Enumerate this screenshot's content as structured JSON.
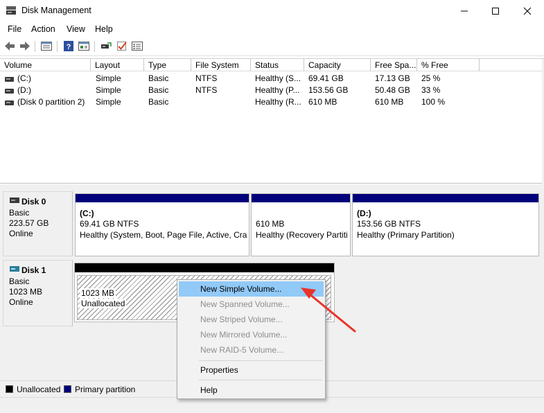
{
  "window": {
    "title": "Disk Management",
    "icon": "disk-management-icon",
    "controls": {
      "minimize": "minimize-icon",
      "maximize": "maximize-icon",
      "close": "close-icon"
    }
  },
  "menu": {
    "items": [
      "File",
      "Action",
      "View",
      "Help"
    ]
  },
  "toolbar": {
    "icons": [
      "back-arrow-icon",
      "forward-arrow-icon",
      "list-view-icon",
      "help-book-icon",
      "properties-icon",
      "connect-icon",
      "checkmark-icon",
      "settings-list-icon"
    ]
  },
  "volume_list": {
    "columns": [
      "Volume",
      "Layout",
      "Type",
      "File System",
      "Status",
      "Capacity",
      "Free Spa...",
      "% Free"
    ],
    "rows": [
      {
        "volume": "(C:)",
        "layout": "Simple",
        "type": "Basic",
        "fs": "NTFS",
        "status": "Healthy (S...",
        "capacity": "69.41 GB",
        "free": "17.13 GB",
        "pct": "25 %"
      },
      {
        "volume": "(D:)",
        "layout": "Simple",
        "type": "Basic",
        "fs": "NTFS",
        "status": "Healthy (P...",
        "capacity": "153.56 GB",
        "free": "50.48 GB",
        "pct": "33 %"
      },
      {
        "volume": "(Disk 0 partition 2)",
        "layout": "Simple",
        "type": "Basic",
        "fs": "",
        "status": "Healthy (R...",
        "capacity": "610 MB",
        "free": "610 MB",
        "pct": "100 %"
      }
    ]
  },
  "disks": [
    {
      "name": "Disk 0",
      "kind": "Basic",
      "size": "223.57 GB",
      "state": "Online",
      "partitions": [
        {
          "label": "(C:)",
          "line1": "69.41 GB NTFS",
          "line2": "Healthy (System, Boot, Page File, Active, Cras"
        },
        {
          "label": "",
          "line1": "610 MB",
          "line2": "Healthy (Recovery Partiti"
        },
        {
          "label": "(D:)",
          "line1": "153.56 GB NTFS",
          "line2": "Healthy (Primary Partition)"
        }
      ]
    },
    {
      "name": "Disk 1",
      "kind": "Basic",
      "size": "1023 MB",
      "state": "Online",
      "partitions": [
        {
          "line1": "1023 MB",
          "line2": "Unallocated"
        }
      ]
    }
  ],
  "legend": [
    {
      "label": "Unallocated",
      "color": "#000000"
    },
    {
      "label": "Primary partition",
      "color": "#00007a"
    }
  ],
  "context_menu": {
    "items": [
      {
        "label": "New Simple Volume...",
        "enabled": true,
        "highlighted": true
      },
      {
        "label": "New Spanned Volume...",
        "enabled": false
      },
      {
        "label": "New Striped Volume...",
        "enabled": false
      },
      {
        "label": "New Mirrored Volume...",
        "enabled": false
      },
      {
        "label": "New RAID-5 Volume...",
        "enabled": false
      },
      {
        "label": "Properties",
        "enabled": true
      },
      {
        "label": "Help",
        "enabled": true
      }
    ]
  },
  "colors": {
    "accent": "#91c9f7",
    "primary_partition": "#00007a",
    "annotation_arrow": "#e8332a"
  }
}
